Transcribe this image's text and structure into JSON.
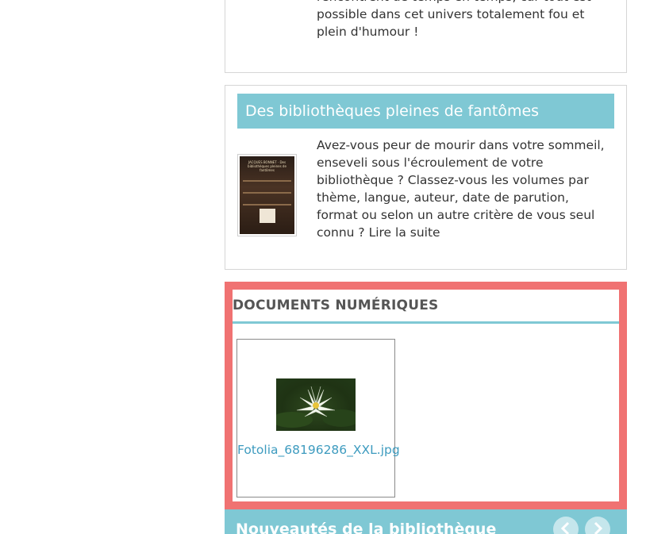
{
  "card1": {
    "text": "rencontrent de temps en temps, car tout est possible dans cet univers totalement fou et plein d'humour !"
  },
  "card2": {
    "title": "Des bibliothèques pleines de fantômes",
    "book_cover_text": "JACQUES BONNET · Des bibliothèques pleines de fantômes",
    "text": "Avez-vous peur de mourir dans votre sommeil, enseveli sous l'écroulement de votre bibliothèque ? Classez-vous les volumes par thème, langue, auteur, date de parution, format ou selon un autre critère de vous seul connu ?",
    "read_more": "Lire la suite"
  },
  "docs": {
    "title": "DOCUMENTS NUMÉRIQUES",
    "items": [
      {
        "filename": "Fotolia_68196286_XXL.jpg",
        "icon": "water-lily-thumbnail"
      }
    ]
  },
  "bottom": {
    "title": "Nouveautés de la bibliothèque",
    "prev_icon": "chevron-left-icon",
    "next_icon": "chevron-right-icon"
  },
  "colors": {
    "accent_teal": "#7fc8d4",
    "docs_border": "#f07272",
    "link": "#3d9bbf"
  }
}
